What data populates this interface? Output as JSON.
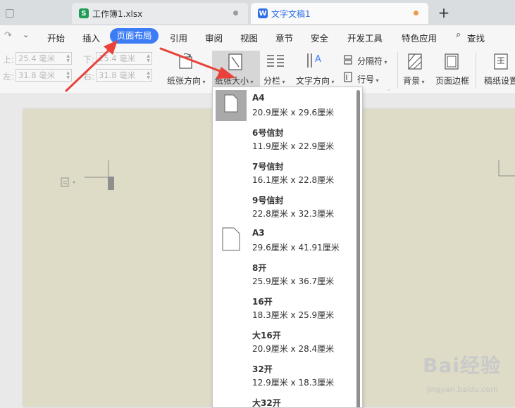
{
  "tabs": [
    {
      "label": "工作簿1.xlsx",
      "icon": "S",
      "color": "#1f9d55"
    },
    {
      "label": "文字文稿1",
      "icon": "W",
      "color": "#2f6fe6"
    }
  ],
  "menu": {
    "items": [
      "开始",
      "插入",
      "页面布局",
      "引用",
      "审阅",
      "视图",
      "章节",
      "安全",
      "开发工具",
      "特色应用",
      "查找"
    ],
    "active": "页面布局"
  },
  "margins": {
    "top_label": "上:",
    "top_value": "25.4 毫米",
    "bottom_label": "下:",
    "bottom_value": "25.4 毫米",
    "left_label": "左:",
    "left_value": "31.8 毫米",
    "right_label": "右:",
    "right_value": "31.8 毫米"
  },
  "ribbon": {
    "orientation": "纸张方向",
    "size": "纸张大小",
    "columns": "分栏",
    "text_direction": "文字方向",
    "separator": "分隔符",
    "line_number": "行号",
    "background": "背景",
    "page_border": "页面边框",
    "draft_settings": "稿纸设置"
  },
  "paper_sizes": [
    {
      "name": "A4",
      "dims": "20.9厘米 x 29.6厘米",
      "selected": true
    },
    {
      "name": "6号信封",
      "dims": "11.9厘米 x 22.9厘米"
    },
    {
      "name": "7号信封",
      "dims": "16.1厘米 x 22.8厘米"
    },
    {
      "name": "9号信封",
      "dims": "22.8厘米 x 32.3厘米"
    },
    {
      "name": "A3",
      "dims": "29.6厘米 x 41.91厘米"
    },
    {
      "name": "8开",
      "dims": "25.9厘米 x 36.7厘米"
    },
    {
      "name": "16开",
      "dims": "18.3厘米 x 25.9厘米"
    },
    {
      "name": "大16开",
      "dims": "20.9厘米 x 28.4厘米"
    },
    {
      "name": "32开",
      "dims": "12.9厘米 x 18.3厘米"
    },
    {
      "name": "大32开",
      "dims": ""
    }
  ],
  "watermark": {
    "text": "Bai经验",
    "sub": "jingyan.baidu.com"
  },
  "colors": {
    "accent": "#3d7cf7",
    "arrow": "#e8423a",
    "page": "#dedbc6"
  }
}
